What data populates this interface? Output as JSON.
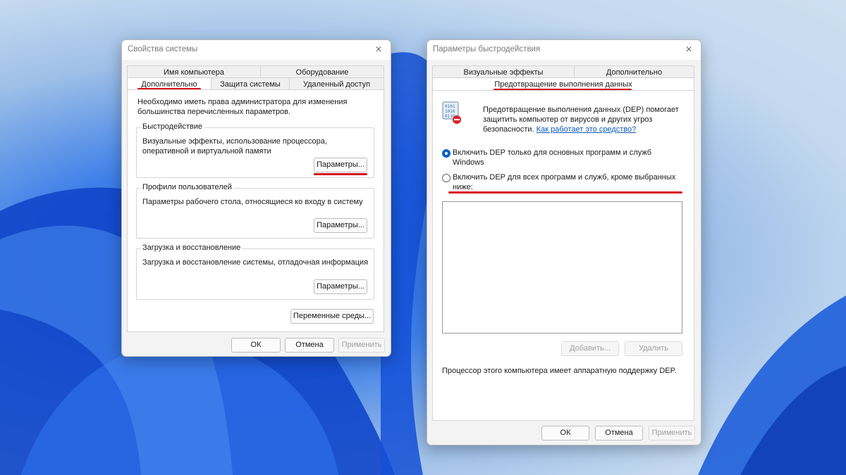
{
  "colors": {
    "accent": "#0b63c6",
    "annotation": "#d8141c",
    "link": "#0a59b8"
  },
  "system_properties": {
    "title": "Свойства системы",
    "close_icon": "×",
    "tabs_row1": [
      "Имя компьютера",
      "Оборудование"
    ],
    "tabs_row2": [
      "Дополнительно",
      "Защита системы",
      "Удаленный доступ"
    ],
    "active_tab": "Дополнительно",
    "admin_note": "Необходимо иметь права администратора для изменения большинства перечисленных параметров.",
    "performance": {
      "label": "Быстродействие",
      "description": "Визуальные эффекты, использование процессора, оперативной и виртуальной памяти",
      "button": "Параметры..."
    },
    "user_profiles": {
      "label": "Профили пользователей",
      "description": "Параметры рабочего стола, относящиеся ко входу в систему",
      "button": "Параметры..."
    },
    "startup_recovery": {
      "label": "Загрузка и восстановление",
      "description": "Загрузка и восстановление системы, отладочная информация",
      "button": "Параметры..."
    },
    "env_button": "Переменные среды...",
    "ok": "ОК",
    "cancel": "Отмена",
    "apply": "Применить"
  },
  "performance_options": {
    "title": "Параметры быстродействия",
    "close_icon": "×",
    "tabs_row1": [
      "Визуальные эффекты",
      "Дополнительно"
    ],
    "active_tab": "Предотвращение выполнения данных",
    "dep_icon": "dep-shield-icon",
    "dep_description_line1": "Предотвращение выполнения данных (DEP) помогает",
    "dep_description_line2": "защитить компьютер от вирусов и других угроз",
    "dep_description_line3": "безопасности.",
    "dep_link": "Как работает это средство?",
    "radio1_line1": "Включить DEP только для основных программ и служб",
    "radio1_line2": "Windows",
    "radio1_checked": true,
    "radio2_line1": "Включить DEP для всех программ и служб, кроме выбранных",
    "radio2_line2": "ниже:",
    "radio2_checked": false,
    "add_button": "Добавить...",
    "remove_button": "Удалить",
    "hardware_support": "Процессор этого компьютера имеет аппаратную поддержку DEP.",
    "ok": "ОК",
    "cancel": "Отмена",
    "apply": "Применить"
  }
}
